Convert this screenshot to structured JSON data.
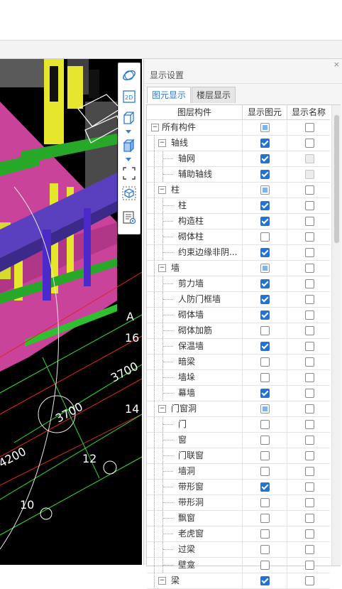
{
  "panel": {
    "title": "显示设置",
    "close": "×",
    "tabs": [
      "图元显示",
      "楼层显示"
    ],
    "columns": [
      "图层构件",
      "显示图元",
      "显示名称"
    ],
    "rows": [
      {
        "label": "所有构件",
        "level": 0,
        "toggle": "−",
        "show": "partial",
        "name": "unchecked"
      },
      {
        "label": "轴线",
        "level": 1,
        "toggle": "−",
        "show": "checked",
        "name": "unchecked"
      },
      {
        "label": "轴网",
        "level": 2,
        "show": "checked",
        "name": "disabled"
      },
      {
        "label": "辅助轴线",
        "level": 2,
        "show": "checked",
        "name": "disabled"
      },
      {
        "label": "柱",
        "level": 1,
        "toggle": "−",
        "show": "partial",
        "name": "unchecked"
      },
      {
        "label": "柱",
        "level": 2,
        "show": "checked",
        "name": "unchecked"
      },
      {
        "label": "构造柱",
        "level": 2,
        "show": "checked",
        "name": "unchecked"
      },
      {
        "label": "砌体柱",
        "level": 2,
        "show": "unchecked",
        "name": "unchecked"
      },
      {
        "label": "约束边缘非阴...",
        "level": 2,
        "show": "checked",
        "name": "unchecked"
      },
      {
        "label": "墙",
        "level": 1,
        "toggle": "−",
        "show": "partial",
        "name": "unchecked"
      },
      {
        "label": "剪力墙",
        "level": 2,
        "show": "checked",
        "name": "unchecked"
      },
      {
        "label": "人防门框墙",
        "level": 2,
        "show": "checked",
        "name": "unchecked"
      },
      {
        "label": "砌体墙",
        "level": 2,
        "show": "checked",
        "name": "unchecked"
      },
      {
        "label": "砌体加筋",
        "level": 2,
        "show": "unchecked",
        "name": "unchecked"
      },
      {
        "label": "保温墙",
        "level": 2,
        "show": "checked",
        "name": "unchecked"
      },
      {
        "label": "暗梁",
        "level": 2,
        "show": "unchecked",
        "name": "unchecked"
      },
      {
        "label": "墙垛",
        "level": 2,
        "show": "unchecked",
        "name": "unchecked"
      },
      {
        "label": "幕墙",
        "level": 2,
        "show": "checked",
        "name": "unchecked"
      },
      {
        "label": "门窗洞",
        "level": 1,
        "toggle": "−",
        "show": "partial",
        "name": "unchecked"
      },
      {
        "label": "门",
        "level": 2,
        "show": "unchecked",
        "name": "unchecked"
      },
      {
        "label": "窗",
        "level": 2,
        "show": "unchecked",
        "name": "unchecked"
      },
      {
        "label": "门联窗",
        "level": 2,
        "show": "unchecked",
        "name": "unchecked"
      },
      {
        "label": "墙洞",
        "level": 2,
        "show": "unchecked",
        "name": "unchecked"
      },
      {
        "label": "带形窗",
        "level": 2,
        "show": "checked",
        "name": "unchecked"
      },
      {
        "label": "带形洞",
        "level": 2,
        "show": "unchecked",
        "name": "unchecked"
      },
      {
        "label": "飘窗",
        "level": 2,
        "show": "unchecked",
        "name": "unchecked"
      },
      {
        "label": "老虎窗",
        "level": 2,
        "show": "unchecked",
        "name": "unchecked"
      },
      {
        "label": "过梁",
        "level": 2,
        "show": "unchecked",
        "name": "unchecked"
      },
      {
        "label": "壁龛",
        "level": 2,
        "show": "unchecked",
        "name": "unchecked"
      },
      {
        "label": "梁",
        "level": 1,
        "toggle": "−",
        "show": "checked",
        "name": "unchecked"
      }
    ]
  },
  "viewport": {
    "dimensions": [
      "3700",
      "3700",
      "4200"
    ],
    "axis_labels": [
      "A",
      "16",
      "14",
      "12",
      "10"
    ]
  },
  "toolbar": {
    "icons": [
      "orbit-icon",
      "view-2d-icon",
      "view-3d-cube-icon",
      "solid-cube-icon",
      "region-select-icon",
      "layer-toggle-icon",
      "display-settings-icon"
    ],
    "label_2d": "2D"
  },
  "colors": {
    "accent": "#1e74d8",
    "slab": "#c9439b",
    "wall_yellow": "#e6e62c",
    "beam_green": "#28a828",
    "beam_blue": "#5a3fbf"
  }
}
